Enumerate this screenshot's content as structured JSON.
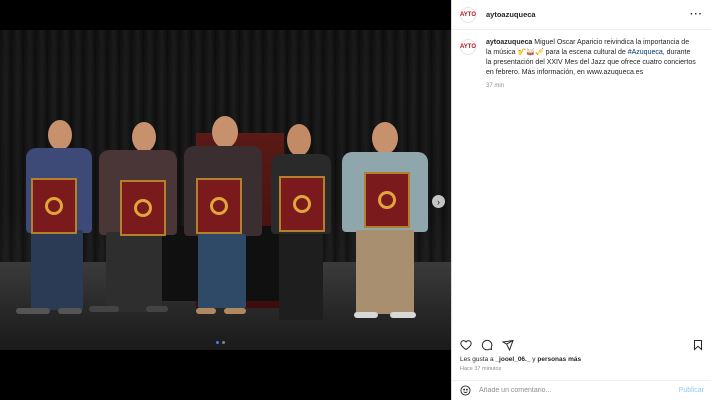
{
  "post": {
    "username": "aytoazuqueca",
    "avatar_text": "AYTO",
    "caption_user": "aytoazuqueca",
    "caption_part1": "Miguel Oscar Aparicio reivindica la importancia de la música 🎷🥁🎺 para la escena cultural de ",
    "hashtag": "#Azuqueca",
    "caption_part2": ", durante la presentación del XXIV Mes del Jazz que ofrece cuatro conciertos en febrero. Más información, en www.azuqueca.es",
    "caption_time": "37 min",
    "likes_prefix": "Les gusta a ",
    "likes_user": "_jooel_06._",
    "likes_mid": " y ",
    "likes_others": "personas más",
    "time_ago": "Hace 37 minutos",
    "comment_placeholder": "Añade un comentario...",
    "publish_label": "Publicar",
    "more_label": "···",
    "next_label": "›"
  },
  "carousel": {
    "total": 2,
    "active": 1
  },
  "icons": {
    "like": "heart-icon",
    "comment": "comment-icon",
    "share": "share-icon",
    "save": "bookmark-icon",
    "emoji": "emoji-icon"
  },
  "colors": {
    "hashtag": "#00376b",
    "publish": "#8fcaf9",
    "poster": "#7a1a1c"
  }
}
